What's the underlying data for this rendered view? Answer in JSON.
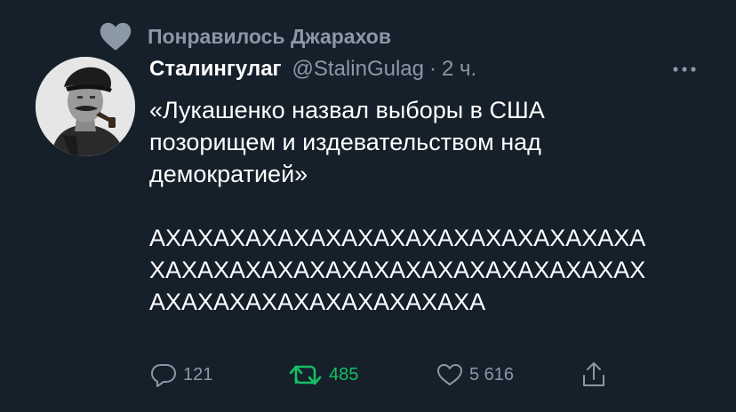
{
  "social_context": {
    "icon": "heart-icon",
    "text": "Понравилось Джарахов"
  },
  "author": {
    "display_name": "Сталингулаг",
    "handle": "@StalinGulag",
    "separator": "·",
    "time": "2 ч."
  },
  "tweet": {
    "line1": "«Лукашенко назвал выборы в США",
    "line2": "позорищем и издевательством над",
    "line3": "демократией»",
    "laugh1": "АХАХАХАХАХАХАХАХАХАХАХАХАХАХАХА",
    "laugh2": "ХАХАХАХАХАХАХАХАХАХАХАХАХАХАХАХ",
    "laugh3": "АХАХАХАХАХАХАХАХАХАХА"
  },
  "actions": {
    "replies": "121",
    "retweets": "485",
    "likes": "5 616"
  },
  "colors": {
    "background": "#15202b",
    "secondary_text": "#8b98a5",
    "retweeted": "#17bf63"
  }
}
